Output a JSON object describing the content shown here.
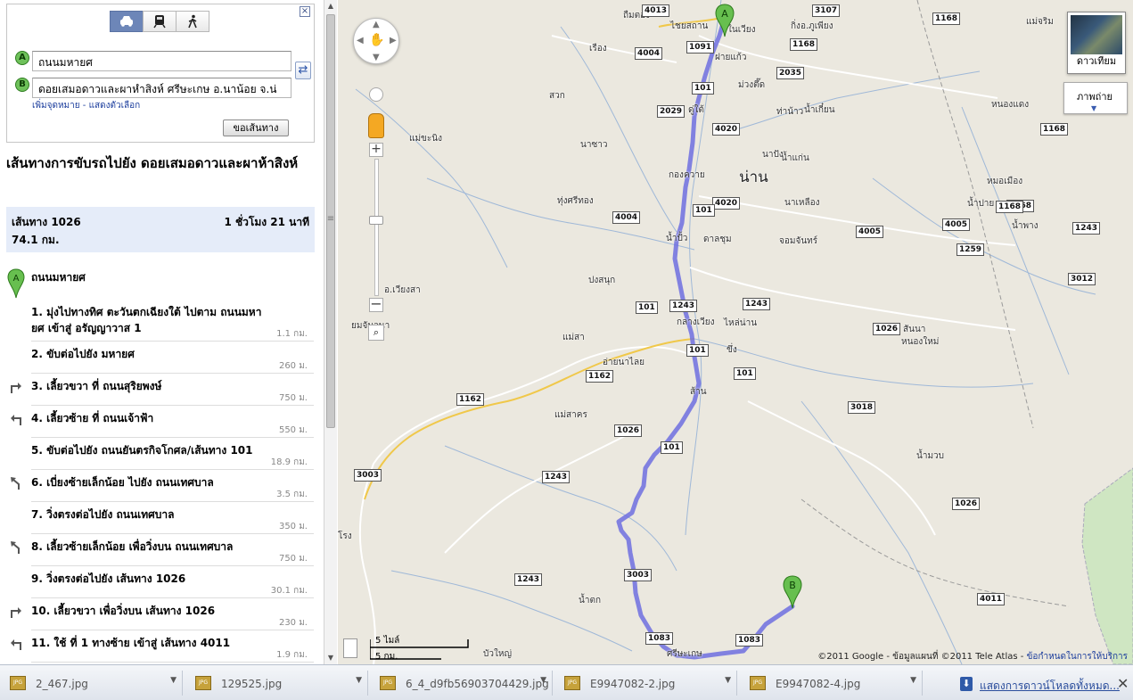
{
  "directions": {
    "modes": [
      {
        "name": "driving",
        "icon": "car-icon",
        "active": true
      },
      {
        "name": "transit",
        "icon": "train-icon",
        "active": false
      },
      {
        "name": "walking",
        "icon": "walk-icon",
        "active": false
      }
    ],
    "close": "×",
    "origin_marker": "A",
    "destination_marker": "B",
    "origin": "ถนนมหายศ",
    "destination": "ดอยเสมอดาวและผาหำสิงห์ ศรีษะเกษ อ.นาน้อย จ.น่",
    "links": "เพิ่มจุดหมาย - แสดงตัวเลือก",
    "get_directions": "ขอเส้นทาง",
    "swap": "⇄"
  },
  "route": {
    "title": "เส้นทางการขับรถไปยัง ดอยเสมอดาวและผาห้าสิงห์",
    "summary_route": "เส้นทาง 1026",
    "summary_time": "1 ชั่วโมง 21 นาที",
    "summary_distance": "74.1 กม.",
    "start_marker": "A",
    "start": "ถนนมหายศ"
  },
  "steps": [
    {
      "text": "1. มุ่งไปทางทิศ ตะวันตกเฉียงใต้ ไปตาม ถนนมหายศ เข้าสู่ อรัญญาวาส 1",
      "dist": "1.1 กม.",
      "turn": ""
    },
    {
      "text": "2. ขับต่อไปยัง มหายศ",
      "dist": "260 ม.",
      "turn": ""
    },
    {
      "text": "3. เลี้ยวขวา ที่ ถนนสุริยพงษ์",
      "dist": "750 ม.",
      "turn": "right"
    },
    {
      "text": "4. เลี้ยวซ้าย ที่ ถนนเจ้าฟ้า",
      "dist": "550 ม.",
      "turn": "left"
    },
    {
      "text": "5. ขับต่อไปยัง ถนนยันตรกิจโกศล/เส้นทาง 101",
      "dist": "18.9 กม.",
      "turn": ""
    },
    {
      "text": "6. เบี่ยงซ้ายเล็กน้อย ไปยัง ถนนเทศบาล",
      "dist": "3.5 กม.",
      "turn": "slight-left"
    },
    {
      "text": "7. วิ่งตรงต่อไปยัง ถนนเทศบาล",
      "dist": "350 ม.",
      "turn": ""
    },
    {
      "text": "8. เลี้ยวซ้ายเล็กน้อย เพื่อวิ่งบน ถนนเทศบาล",
      "dist": "750 ม.",
      "turn": "slight-left"
    },
    {
      "text": "9. วิ่งตรงต่อไปยัง เส้นทาง 1026",
      "dist": "30.1 กม.",
      "turn": ""
    },
    {
      "text": "10. เลี้ยวขวา เพื่อวิ่งบน เส้นทาง 1026",
      "dist": "230 ม.",
      "turn": "right"
    },
    {
      "text": "11. ใช้ ที่ 1 ทางซ้าย เข้าสู่ เส้นทาง 4011",
      "dist": "1.9 กม.",
      "turn": "left"
    }
  ],
  "sidebar_splitter": "≡",
  "map": {
    "marker_a": "A",
    "marker_b": "B",
    "satellite_label": "ดาวเทียม",
    "photo_label": "ภาพถ่าย",
    "scale_miles": "5 ไมล์",
    "scale_km": "5 กม.",
    "copyright": "©2011 Google - ข้อมูลแผนที่ ©2011 Tele Atlas - ",
    "terms": "ข้อกำหนดในการให้บริการ",
    "places": [
      {
        "label": "ถืมตอง",
        "big": false
      },
      {
        "label": "ไชยสถาน",
        "big": false
      },
      {
        "label": "ในเวียง",
        "big": false
      },
      {
        "label": "กิ่งอ.ภูเพียง",
        "big": false
      },
      {
        "label": "แม่จริม",
        "big": false
      },
      {
        "label": "เรือง",
        "big": false
      },
      {
        "label": "ฝายแก้ว",
        "big": false
      },
      {
        "label": "ม่วงตึ๊ด",
        "big": false
      },
      {
        "label": "สวก",
        "big": false
      },
      {
        "label": "ดู่ใต้",
        "big": false
      },
      {
        "label": "ท่าน้าว",
        "big": false
      },
      {
        "label": "น้ำเกี๋ยน",
        "big": false
      },
      {
        "label": "หนองแดง",
        "big": false
      },
      {
        "label": "แม่ขะนิง",
        "big": false
      },
      {
        "label": "นาซาว",
        "big": false
      },
      {
        "label": "นาปัง",
        "big": false
      },
      {
        "label": "น้ำแก่น",
        "big": false
      },
      {
        "label": "กองควาย",
        "big": false
      },
      {
        "label": "น่าน",
        "big": true
      },
      {
        "label": "หมอเมือง",
        "big": false
      },
      {
        "label": "ทุ่งศรีทอง",
        "big": false
      },
      {
        "label": "นาเหลือง",
        "big": false
      },
      {
        "label": "น้ำปาย",
        "big": false
      },
      {
        "label": "น้ำพาง",
        "big": false
      },
      {
        "label": "น้ำปั้ว",
        "big": false
      },
      {
        "label": "ดาลชุม",
        "big": false
      },
      {
        "label": "จอมจันทร์",
        "big": false
      },
      {
        "label": "ปงสนุก",
        "big": false
      },
      {
        "label": "อ.เวียงสา",
        "big": false
      },
      {
        "label": "กลางเวียง",
        "big": false
      },
      {
        "label": "ไหล่น่าน",
        "big": false
      },
      {
        "label": "แม่สา",
        "big": false
      },
      {
        "label": "ยมจันวนา",
        "big": false
      },
      {
        "label": "สันนา",
        "big": false
      },
      {
        "label": "หนองใหม่",
        "big": false
      },
      {
        "label": "อ่ายนาไลย",
        "big": false
      },
      {
        "label": "ขึ่ง",
        "big": false
      },
      {
        "label": "ส้าน",
        "big": false
      },
      {
        "label": "แม่สาคร",
        "big": false
      },
      {
        "label": "น้ำมวบ",
        "big": false
      },
      {
        "label": "น้ำตก",
        "big": false
      },
      {
        "label": "บัวใหญ่",
        "big": false
      },
      {
        "label": "ศรีษะเกษ",
        "big": false
      },
      {
        "label": "โรง",
        "big": false
      }
    ],
    "shields": [
      "4013",
      "3107",
      "1168",
      "1091",
      "4004",
      "1168",
      "2035",
      "101",
      "2029",
      "4020",
      "1168",
      "4020",
      "101",
      "4004",
      "1168",
      "4005",
      "4005",
      "1168",
      "1243",
      "1259",
      "3012",
      "101",
      "1243",
      "1243",
      "1026",
      "101",
      "1162",
      "101",
      "1162",
      "3018",
      "1026",
      "101",
      "3003",
      "1243",
      "1026",
      "3003",
      "1243",
      "4011",
      "1083",
      "1083"
    ]
  },
  "downloads": {
    "items": [
      "2_467.jpg",
      "129525.jpg",
      "6_4_d9fb56903704429.jpg",
      "E9947082-2.jpg",
      "E9947082-4.jpg"
    ],
    "icon_label": "JPG",
    "show_all": "แสดงการดาวน์โหลดทั้งหมด...",
    "close": "✕"
  }
}
